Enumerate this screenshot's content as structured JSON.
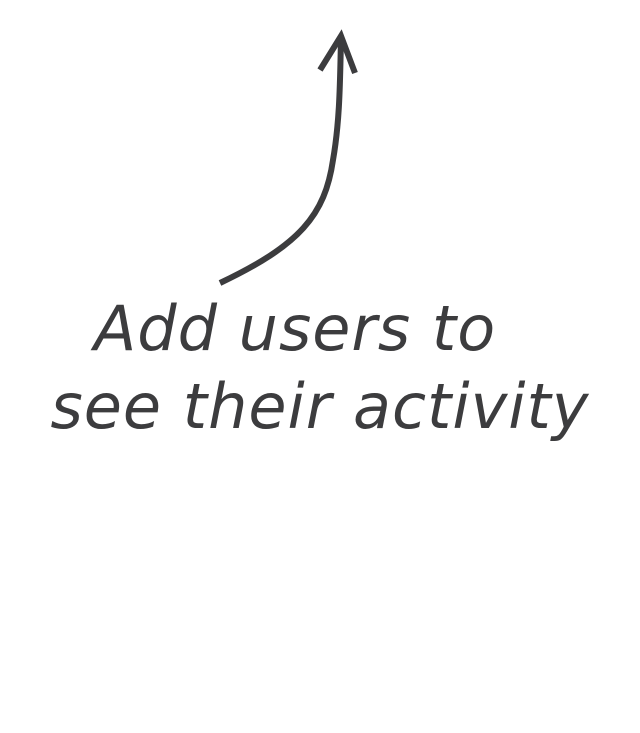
{
  "empty_state": {
    "icon": "curved-arrow-up-icon",
    "message_line_1": "Add users to",
    "message_line_2": "see their activity",
    "text_color": "#3c3c3e"
  }
}
